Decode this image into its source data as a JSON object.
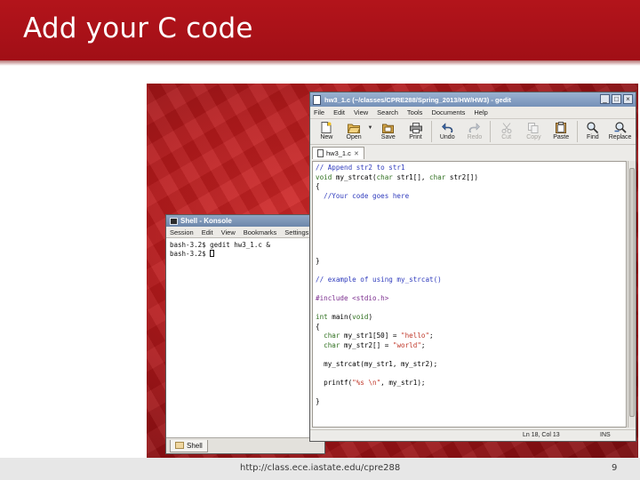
{
  "slide": {
    "title": "Add your C code",
    "footer_url": "http://class.ece.iastate.edu/cpre288",
    "page_number": "9"
  },
  "colors": {
    "header_red": "#b3141b",
    "desktop_red": "#c21f22",
    "titlebar_blue": "#7f98bd"
  },
  "konsole": {
    "title": "Shell - Konsole",
    "menu": [
      "Session",
      "Edit",
      "View",
      "Bookmarks",
      "Settings"
    ],
    "lines": [
      "bash-3.2$ gedit hw3_1.c &",
      "bash-3.2$ "
    ],
    "tab_label": "Shell"
  },
  "gedit": {
    "title": "hw3_1.c (~/classes/CPRE288/Spring_2013/HW/HW3) - gedit",
    "menu": [
      "File",
      "Edit",
      "View",
      "Search",
      "Tools",
      "Documents",
      "Help"
    ],
    "toolbar": {
      "new": "New",
      "open": "Open",
      "save": "Save",
      "print": "Print",
      "undo": "Undo",
      "redo": "Redo",
      "cut": "Cut",
      "copy": "Copy",
      "paste": "Paste",
      "find": "Find",
      "replace": "Replace"
    },
    "tab_label": "hw3_1.c",
    "status": {
      "position": "Ln 18, Col 13",
      "mode": "INS"
    }
  },
  "code_lines": [
    "// Append str2 to str1",
    "void my_strcat(char str1[], char str2[])",
    "{",
    "  //Your code goes here",
    "",
    "",
    "",
    "",
    "",
    "",
    "}",
    "",
    "// example of using my_strcat()",
    "",
    "#include <stdio.h>",
    "",
    "int main(void)",
    "{",
    "  char my_str1[50] = \"hello\";",
    "  char my_str2[] = \"world\";",
    "",
    "  my_strcat(my_str1, my_str2);",
    "",
    "  printf(\"%s \\n\", my_str1);",
    "",
    "}"
  ]
}
